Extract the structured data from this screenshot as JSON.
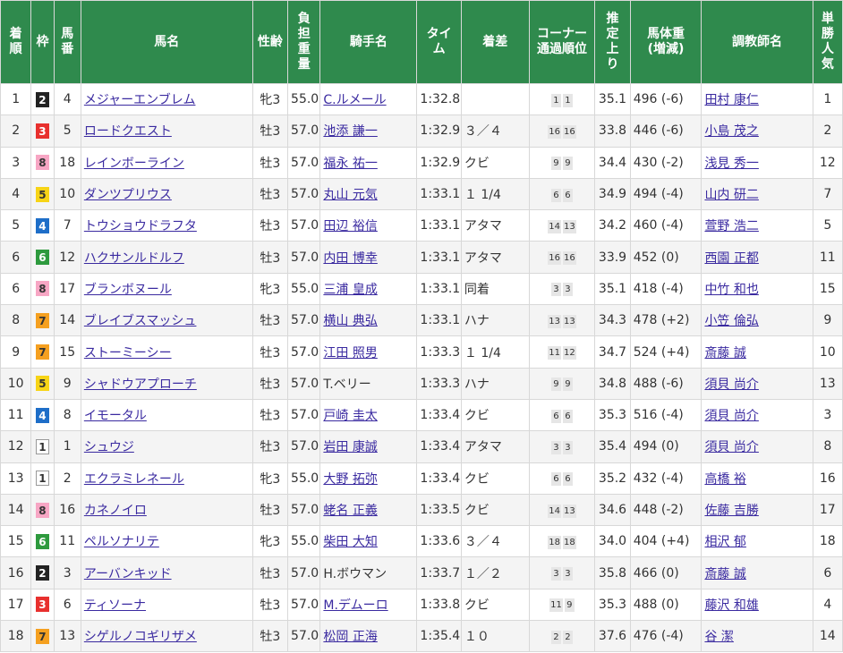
{
  "headers": {
    "rank": [
      "着",
      "順"
    ],
    "waku": [
      "枠"
    ],
    "umaban": [
      "馬",
      "番"
    ],
    "name": [
      "馬名"
    ],
    "sexage": [
      "性齢"
    ],
    "weight": [
      "負",
      "担",
      "重",
      "量"
    ],
    "jockey": [
      "騎手名"
    ],
    "time": [
      "タイ",
      "ム"
    ],
    "margin": [
      "着差"
    ],
    "corner": [
      "コーナー",
      "通過順位"
    ],
    "last3f": [
      "推",
      "定",
      "上",
      "り"
    ],
    "horseweight": [
      "馬体重",
      "(増減)"
    ],
    "trainer": [
      "調教師名"
    ],
    "pop": [
      "単",
      "勝",
      "人",
      "気"
    ]
  },
  "waku_colors": {
    "1": {
      "bg": "#ffffff",
      "fg": "#333333",
      "border": "#999999"
    },
    "2": {
      "bg": "#222222",
      "fg": "#ffffff",
      "border": "#222222"
    },
    "3": {
      "bg": "#e8302e",
      "fg": "#ffffff",
      "border": "#e8302e"
    },
    "4": {
      "bg": "#1e6ec8",
      "fg": "#ffffff",
      "border": "#1e6ec8"
    },
    "5": {
      "bg": "#f7d417",
      "fg": "#333333",
      "border": "#f7d417"
    },
    "6": {
      "bg": "#2e9a3e",
      "fg": "#ffffff",
      "border": "#2e9a3e"
    },
    "7": {
      "bg": "#f5a020",
      "fg": "#333333",
      "border": "#f5a020"
    },
    "8": {
      "bg": "#f7a6c4",
      "fg": "#333333",
      "border": "#f7a6c4"
    }
  },
  "rows": [
    {
      "rank": "1",
      "waku": "2",
      "umaban": "4",
      "name": "メジャーエンブレム",
      "sexage": "牝3",
      "weight": "55.0",
      "jockey": "C.ルメール",
      "jockey_link": true,
      "time": "1:32.8",
      "margin": "",
      "corner": [
        "1",
        "1"
      ],
      "last3f": "35.1",
      "horseweight": "496 (-6)",
      "trainer": "田村 康仁",
      "trainer_link": true,
      "pop": "1"
    },
    {
      "rank": "2",
      "waku": "3",
      "umaban": "5",
      "name": "ロードクエスト",
      "sexage": "牡3",
      "weight": "57.0",
      "jockey": "池添 謙一",
      "jockey_link": true,
      "time": "1:32.9",
      "margin": "３／４",
      "corner": [
        "16",
        "16"
      ],
      "last3f": "33.8",
      "horseweight": "446 (-6)",
      "trainer": "小島 茂之",
      "trainer_link": true,
      "pop": "2"
    },
    {
      "rank": "3",
      "waku": "8",
      "umaban": "18",
      "name": "レインボーライン",
      "sexage": "牡3",
      "weight": "57.0",
      "jockey": "福永 祐一",
      "jockey_link": true,
      "time": "1:32.9",
      "margin": "クビ",
      "corner": [
        "9",
        "9"
      ],
      "last3f": "34.4",
      "horseweight": "430 (-2)",
      "trainer": "浅見 秀一",
      "trainer_link": true,
      "pop": "12"
    },
    {
      "rank": "4",
      "waku": "5",
      "umaban": "10",
      "name": "ダンツプリウス",
      "sexage": "牡3",
      "weight": "57.0",
      "jockey": "丸山 元気",
      "jockey_link": true,
      "time": "1:33.1",
      "margin": "１ 1/4",
      "corner": [
        "6",
        "6"
      ],
      "last3f": "34.9",
      "horseweight": "494 (-4)",
      "trainer": "山内 研二",
      "trainer_link": true,
      "pop": "7"
    },
    {
      "rank": "5",
      "waku": "4",
      "umaban": "7",
      "name": "トウショウドラフタ",
      "sexage": "牡3",
      "weight": "57.0",
      "jockey": "田辺 裕信",
      "jockey_link": true,
      "time": "1:33.1",
      "margin": "アタマ",
      "corner": [
        "14",
        "13"
      ],
      "last3f": "34.2",
      "horseweight": "460 (-4)",
      "trainer": "萱野 浩二",
      "trainer_link": true,
      "pop": "5"
    },
    {
      "rank": "6",
      "waku": "6",
      "umaban": "12",
      "name": "ハクサンルドルフ",
      "sexage": "牡3",
      "weight": "57.0",
      "jockey": "内田 博幸",
      "jockey_link": true,
      "time": "1:33.1",
      "margin": "アタマ",
      "corner": [
        "16",
        "16"
      ],
      "last3f": "33.9",
      "horseweight": "452 (0)",
      "trainer": "西園 正都",
      "trainer_link": true,
      "pop": "11"
    },
    {
      "rank": "6",
      "waku": "8",
      "umaban": "17",
      "name": "ブランボヌール",
      "sexage": "牝3",
      "weight": "55.0",
      "jockey": "三浦 皇成",
      "jockey_link": true,
      "time": "1:33.1",
      "margin": "同着",
      "corner": [
        "3",
        "3"
      ],
      "last3f": "35.1",
      "horseweight": "418 (-4)",
      "trainer": "中竹 和也",
      "trainer_link": true,
      "pop": "15"
    },
    {
      "rank": "8",
      "waku": "7",
      "umaban": "14",
      "name": "ブレイブスマッシュ",
      "sexage": "牡3",
      "weight": "57.0",
      "jockey": "横山 典弘",
      "jockey_link": true,
      "time": "1:33.1",
      "margin": "ハナ",
      "corner": [
        "13",
        "13"
      ],
      "last3f": "34.3",
      "horseweight": "478 (+2)",
      "trainer": "小笠 倫弘",
      "trainer_link": true,
      "pop": "9"
    },
    {
      "rank": "9",
      "waku": "7",
      "umaban": "15",
      "name": "ストーミーシー",
      "sexage": "牡3",
      "weight": "57.0",
      "jockey": "江田 照男",
      "jockey_link": true,
      "time": "1:33.3",
      "margin": "１ 1/4",
      "corner": [
        "11",
        "12"
      ],
      "last3f": "34.7",
      "horseweight": "524 (+4)",
      "trainer": "斎藤 誠",
      "trainer_link": true,
      "pop": "10"
    },
    {
      "rank": "10",
      "waku": "5",
      "umaban": "9",
      "name": "シャドウアプローチ",
      "sexage": "牡3",
      "weight": "57.0",
      "jockey": "T.ベリー",
      "jockey_link": false,
      "time": "1:33.3",
      "margin": "ハナ",
      "corner": [
        "9",
        "9"
      ],
      "last3f": "34.8",
      "horseweight": "488 (-6)",
      "trainer": "須貝 尚介",
      "trainer_link": true,
      "pop": "13"
    },
    {
      "rank": "11",
      "waku": "4",
      "umaban": "8",
      "name": "イモータル",
      "sexage": "牡3",
      "weight": "57.0",
      "jockey": "戸崎 圭太",
      "jockey_link": true,
      "time": "1:33.4",
      "margin": "クビ",
      "corner": [
        "6",
        "6"
      ],
      "last3f": "35.3",
      "horseweight": "516 (-4)",
      "trainer": "須貝 尚介",
      "trainer_link": true,
      "pop": "3"
    },
    {
      "rank": "12",
      "waku": "1",
      "umaban": "1",
      "name": "シュウジ",
      "sexage": "牡3",
      "weight": "57.0",
      "jockey": "岩田 康誠",
      "jockey_link": true,
      "time": "1:33.4",
      "margin": "アタマ",
      "corner": [
        "3",
        "3"
      ],
      "last3f": "35.4",
      "horseweight": "494 (0)",
      "trainer": "須貝 尚介",
      "trainer_link": true,
      "pop": "8"
    },
    {
      "rank": "13",
      "waku": "1",
      "umaban": "2",
      "name": "エクラミレネール",
      "sexage": "牝3",
      "weight": "55.0",
      "jockey": "大野 拓弥",
      "jockey_link": true,
      "time": "1:33.4",
      "margin": "クビ",
      "corner": [
        "6",
        "6"
      ],
      "last3f": "35.2",
      "horseweight": "432 (-4)",
      "trainer": "高橋 裕",
      "trainer_link": true,
      "pop": "16"
    },
    {
      "rank": "14",
      "waku": "8",
      "umaban": "16",
      "name": "カネノイロ",
      "sexage": "牡3",
      "weight": "57.0",
      "jockey": "蛯名 正義",
      "jockey_link": true,
      "time": "1:33.5",
      "margin": "クビ",
      "corner": [
        "14",
        "13"
      ],
      "last3f": "34.6",
      "horseweight": "448 (-2)",
      "trainer": "佐藤 吉勝",
      "trainer_link": true,
      "pop": "17"
    },
    {
      "rank": "15",
      "waku": "6",
      "umaban": "11",
      "name": "ペルソナリテ",
      "sexage": "牝3",
      "weight": "55.0",
      "jockey": "柴田 大知",
      "jockey_link": true,
      "time": "1:33.6",
      "margin": "３／４",
      "corner": [
        "18",
        "18"
      ],
      "last3f": "34.0",
      "horseweight": "404 (+4)",
      "trainer": "相沢 郁",
      "trainer_link": true,
      "pop": "18"
    },
    {
      "rank": "16",
      "waku": "2",
      "umaban": "3",
      "name": "アーバンキッド",
      "sexage": "牡3",
      "weight": "57.0",
      "jockey": "H.ボウマン",
      "jockey_link": false,
      "time": "1:33.7",
      "margin": "１／２",
      "corner": [
        "3",
        "3"
      ],
      "last3f": "35.8",
      "horseweight": "466 (0)",
      "trainer": "斎藤 誠",
      "trainer_link": true,
      "pop": "6"
    },
    {
      "rank": "17",
      "waku": "3",
      "umaban": "6",
      "name": "ティソーナ",
      "sexage": "牡3",
      "weight": "57.0",
      "jockey": "M.デムーロ",
      "jockey_link": true,
      "time": "1:33.8",
      "margin": "クビ",
      "corner": [
        "11",
        "9"
      ],
      "last3f": "35.3",
      "horseweight": "488 (0)",
      "trainer": "藤沢 和雄",
      "trainer_link": true,
      "pop": "4"
    },
    {
      "rank": "18",
      "waku": "7",
      "umaban": "13",
      "name": "シゲルノコギリザメ",
      "sexage": "牡3",
      "weight": "57.0",
      "jockey": "松岡 正海",
      "jockey_link": true,
      "time": "1:35.4",
      "margin": "１０",
      "corner": [
        "2",
        "2"
      ],
      "last3f": "37.6",
      "horseweight": "476 (-4)",
      "trainer": "谷 潔",
      "trainer_link": true,
      "pop": "14"
    }
  ]
}
